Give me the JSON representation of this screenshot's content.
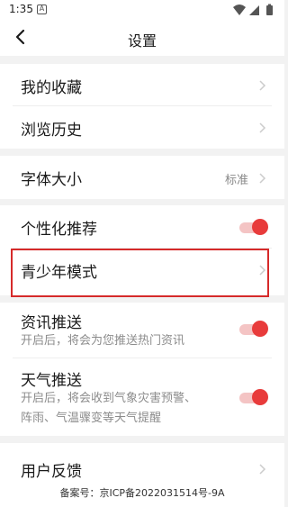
{
  "status_bar": {
    "time": "1:35",
    "notification_badge": "A"
  },
  "header": {
    "title": "设置",
    "back_icon": "chevron-left-icon"
  },
  "settings": {
    "favorites": {
      "label": "我的收藏"
    },
    "history": {
      "label": "浏览历史"
    },
    "font_size": {
      "label": "字体大小",
      "value": "标准"
    },
    "personalized": {
      "label": "个性化推荐",
      "enabled": true
    },
    "youth_mode": {
      "label": "青少年模式"
    },
    "news_push": {
      "label": "资讯推送",
      "description": "开启后，将会为您推送热门资讯",
      "enabled": true
    },
    "weather_push": {
      "label": "天气推送",
      "description_line1": "开启后，将会收到气象灾害预警、",
      "description_line2": "阵雨、气温骤变等天气提醒",
      "enabled": true
    },
    "feedback": {
      "label": "用户反馈"
    }
  },
  "footer": {
    "icp": "备案号：京ICP备2022031514号-9A"
  },
  "colors": {
    "accent": "#e83b3b",
    "highlight_border": "#d62a2a",
    "background": "#f2f2f2"
  }
}
